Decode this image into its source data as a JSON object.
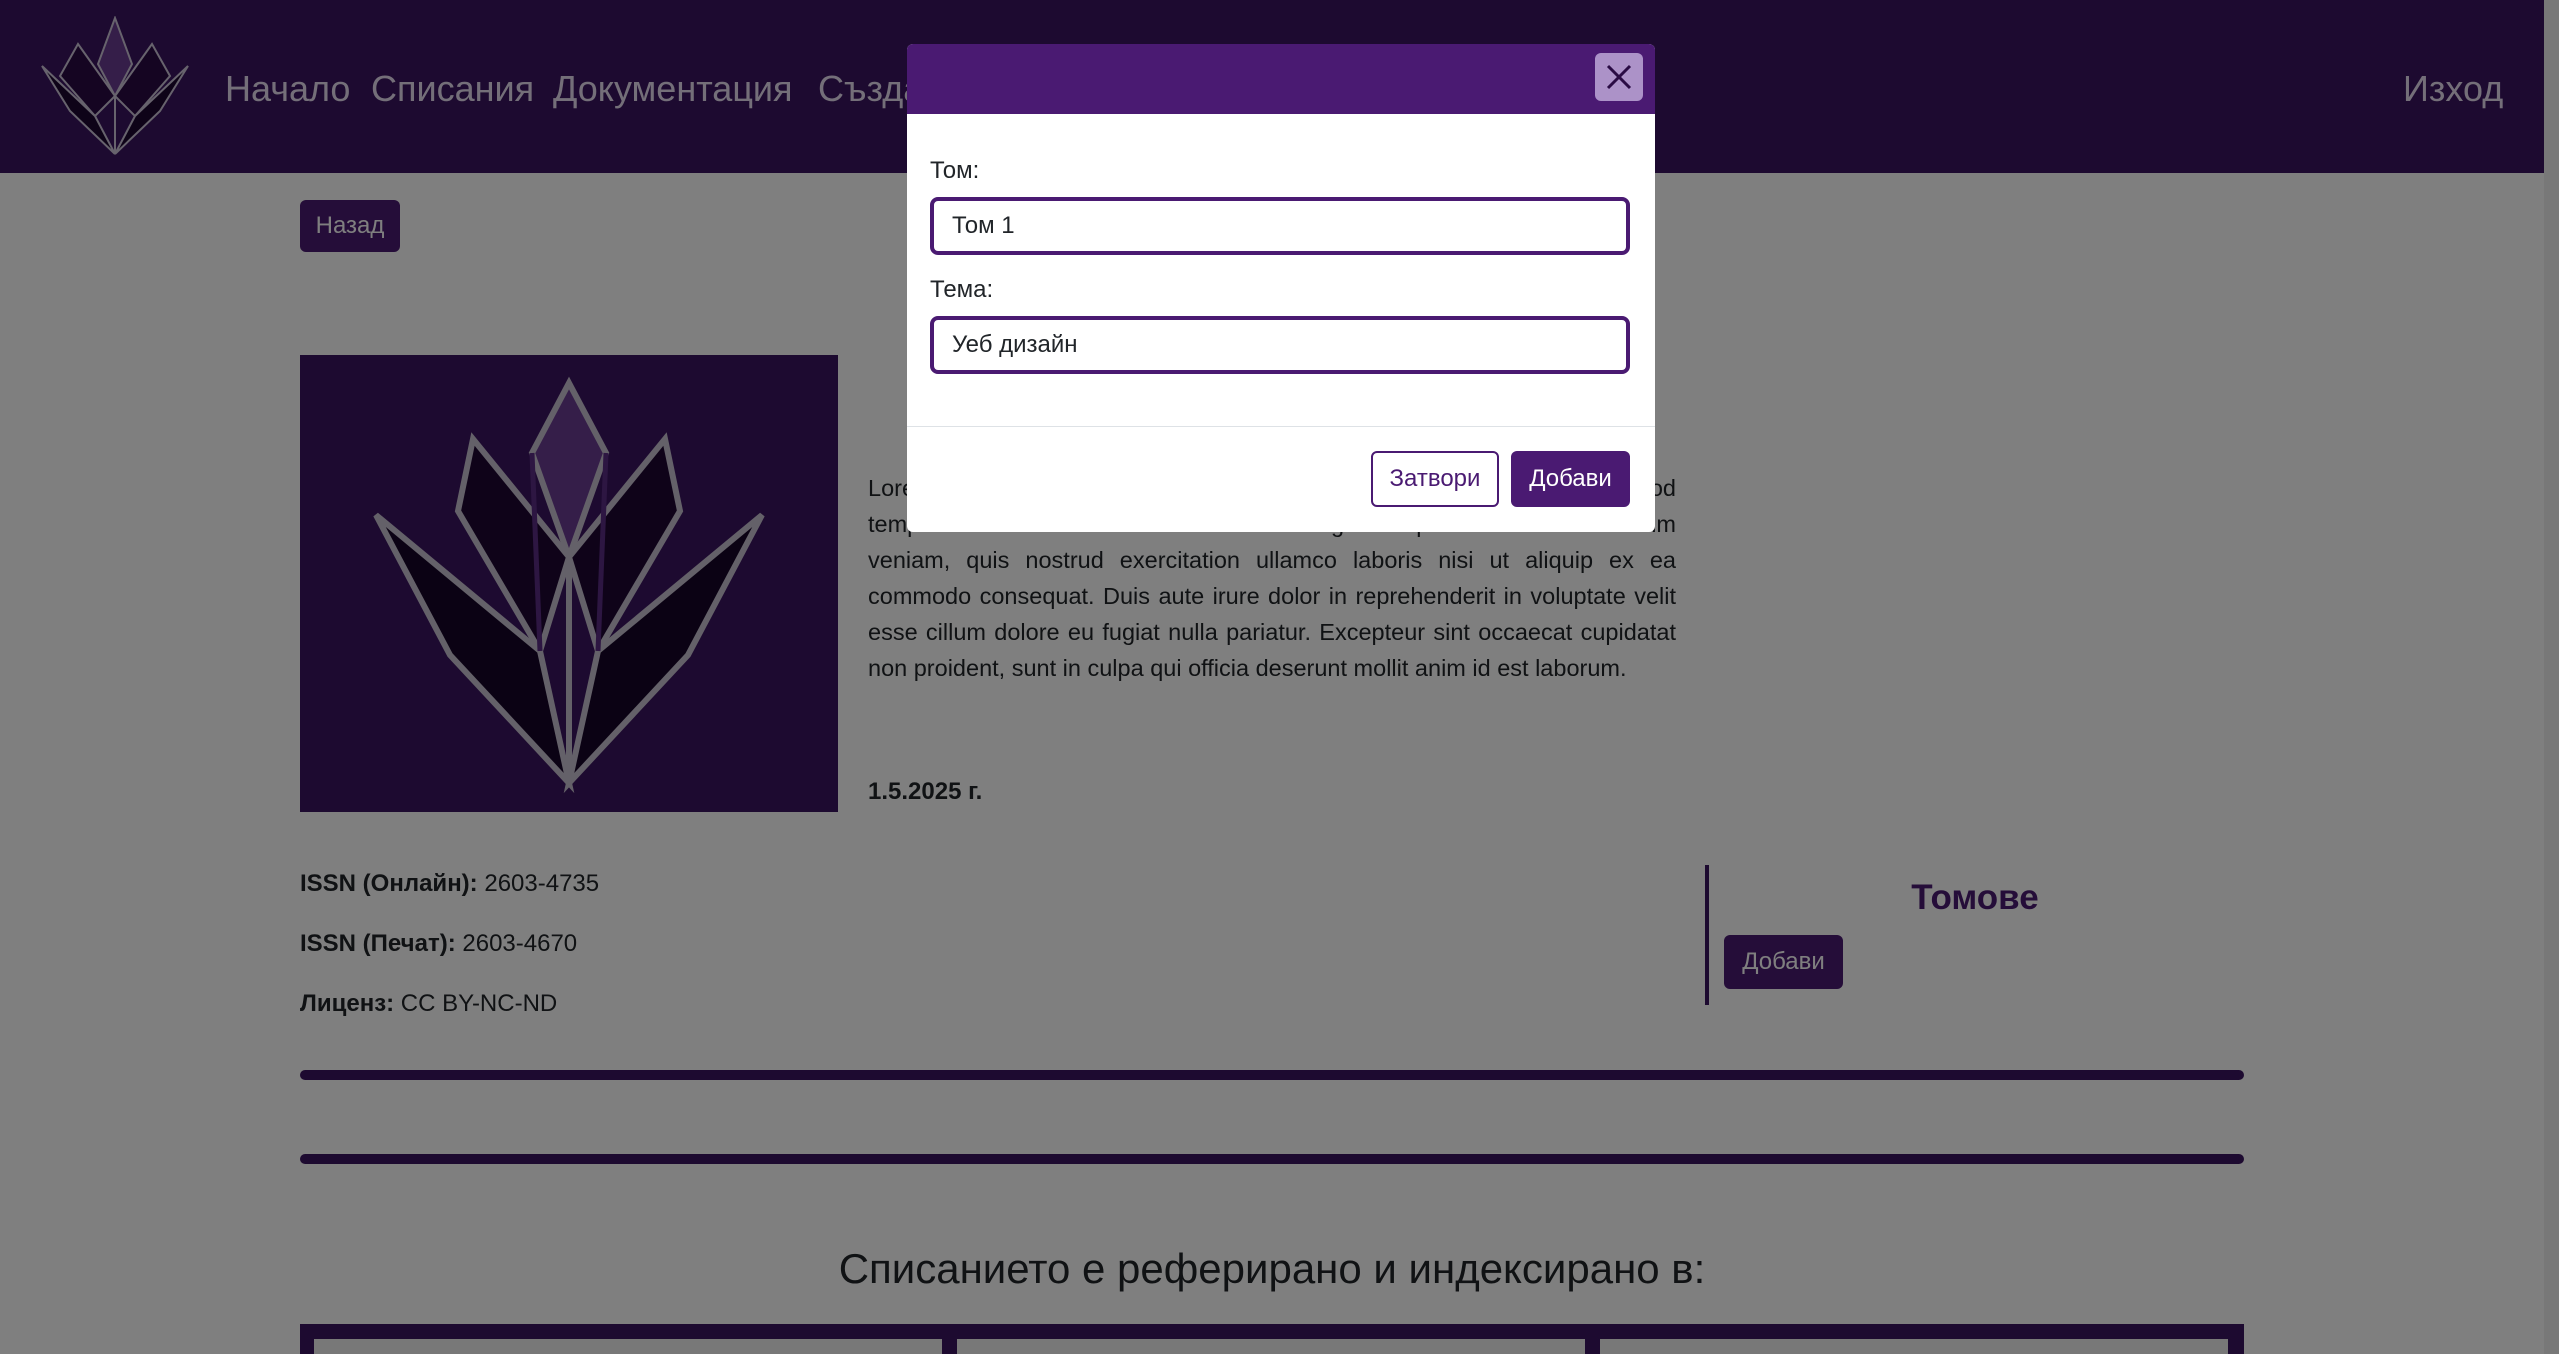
{
  "colors": {
    "brand": "#3b1460",
    "accent": "#4a1a72",
    "close_button_bg": "#ac92c8"
  },
  "navbar": {
    "logo_icon": "lotus-logo-icon",
    "items": [
      {
        "label": "Начало"
      },
      {
        "label": "Списания"
      },
      {
        "label": "Документация"
      },
      {
        "label": "Създа"
      }
    ],
    "logout_label": "Изход"
  },
  "page": {
    "back_label": "Назад",
    "journal_image_icon": "lotus-logo-icon",
    "description_hidden_prefix": "Lore",
    "description_hidden_suffix": "od",
    "description_line2_visible": "tempor incididunt ut labore et dolore magna aliqua. Ut enim ad minim",
    "description_body": "veniam, quis nostrud exercitation ullamco laboris nisi ut aliquip ex ea commodo consequat. Duis aute irure dolor in reprehenderit in voluptate velit esse cillum dolore eu fugiat nulla pariatur. Excepteur sint occaecat cupidatat non proident, sunt in culpa qui officia deserunt mollit anim id est laborum.",
    "date": "1.5.2025 г.",
    "meta": [
      {
        "label": "ISSN (Онлайн):",
        "value": "2603-4735"
      },
      {
        "label": "ISSN (Печат):",
        "value": "2603-4670"
      },
      {
        "label": "Лиценз:",
        "value": "CC BY-NC-ND"
      }
    ],
    "volumes_title": "Томове",
    "volumes_add_label": "Добави",
    "indexed_title": "Списанието е реферирано и индексирано в:"
  },
  "modal": {
    "close_icon": "close-icon",
    "volume_label": "Том:",
    "volume_value": "Том 1",
    "topic_label": "Тема:",
    "topic_value": "Уеб дизайн",
    "close_button_label": "Затвори",
    "add_button_label": "Добави"
  }
}
